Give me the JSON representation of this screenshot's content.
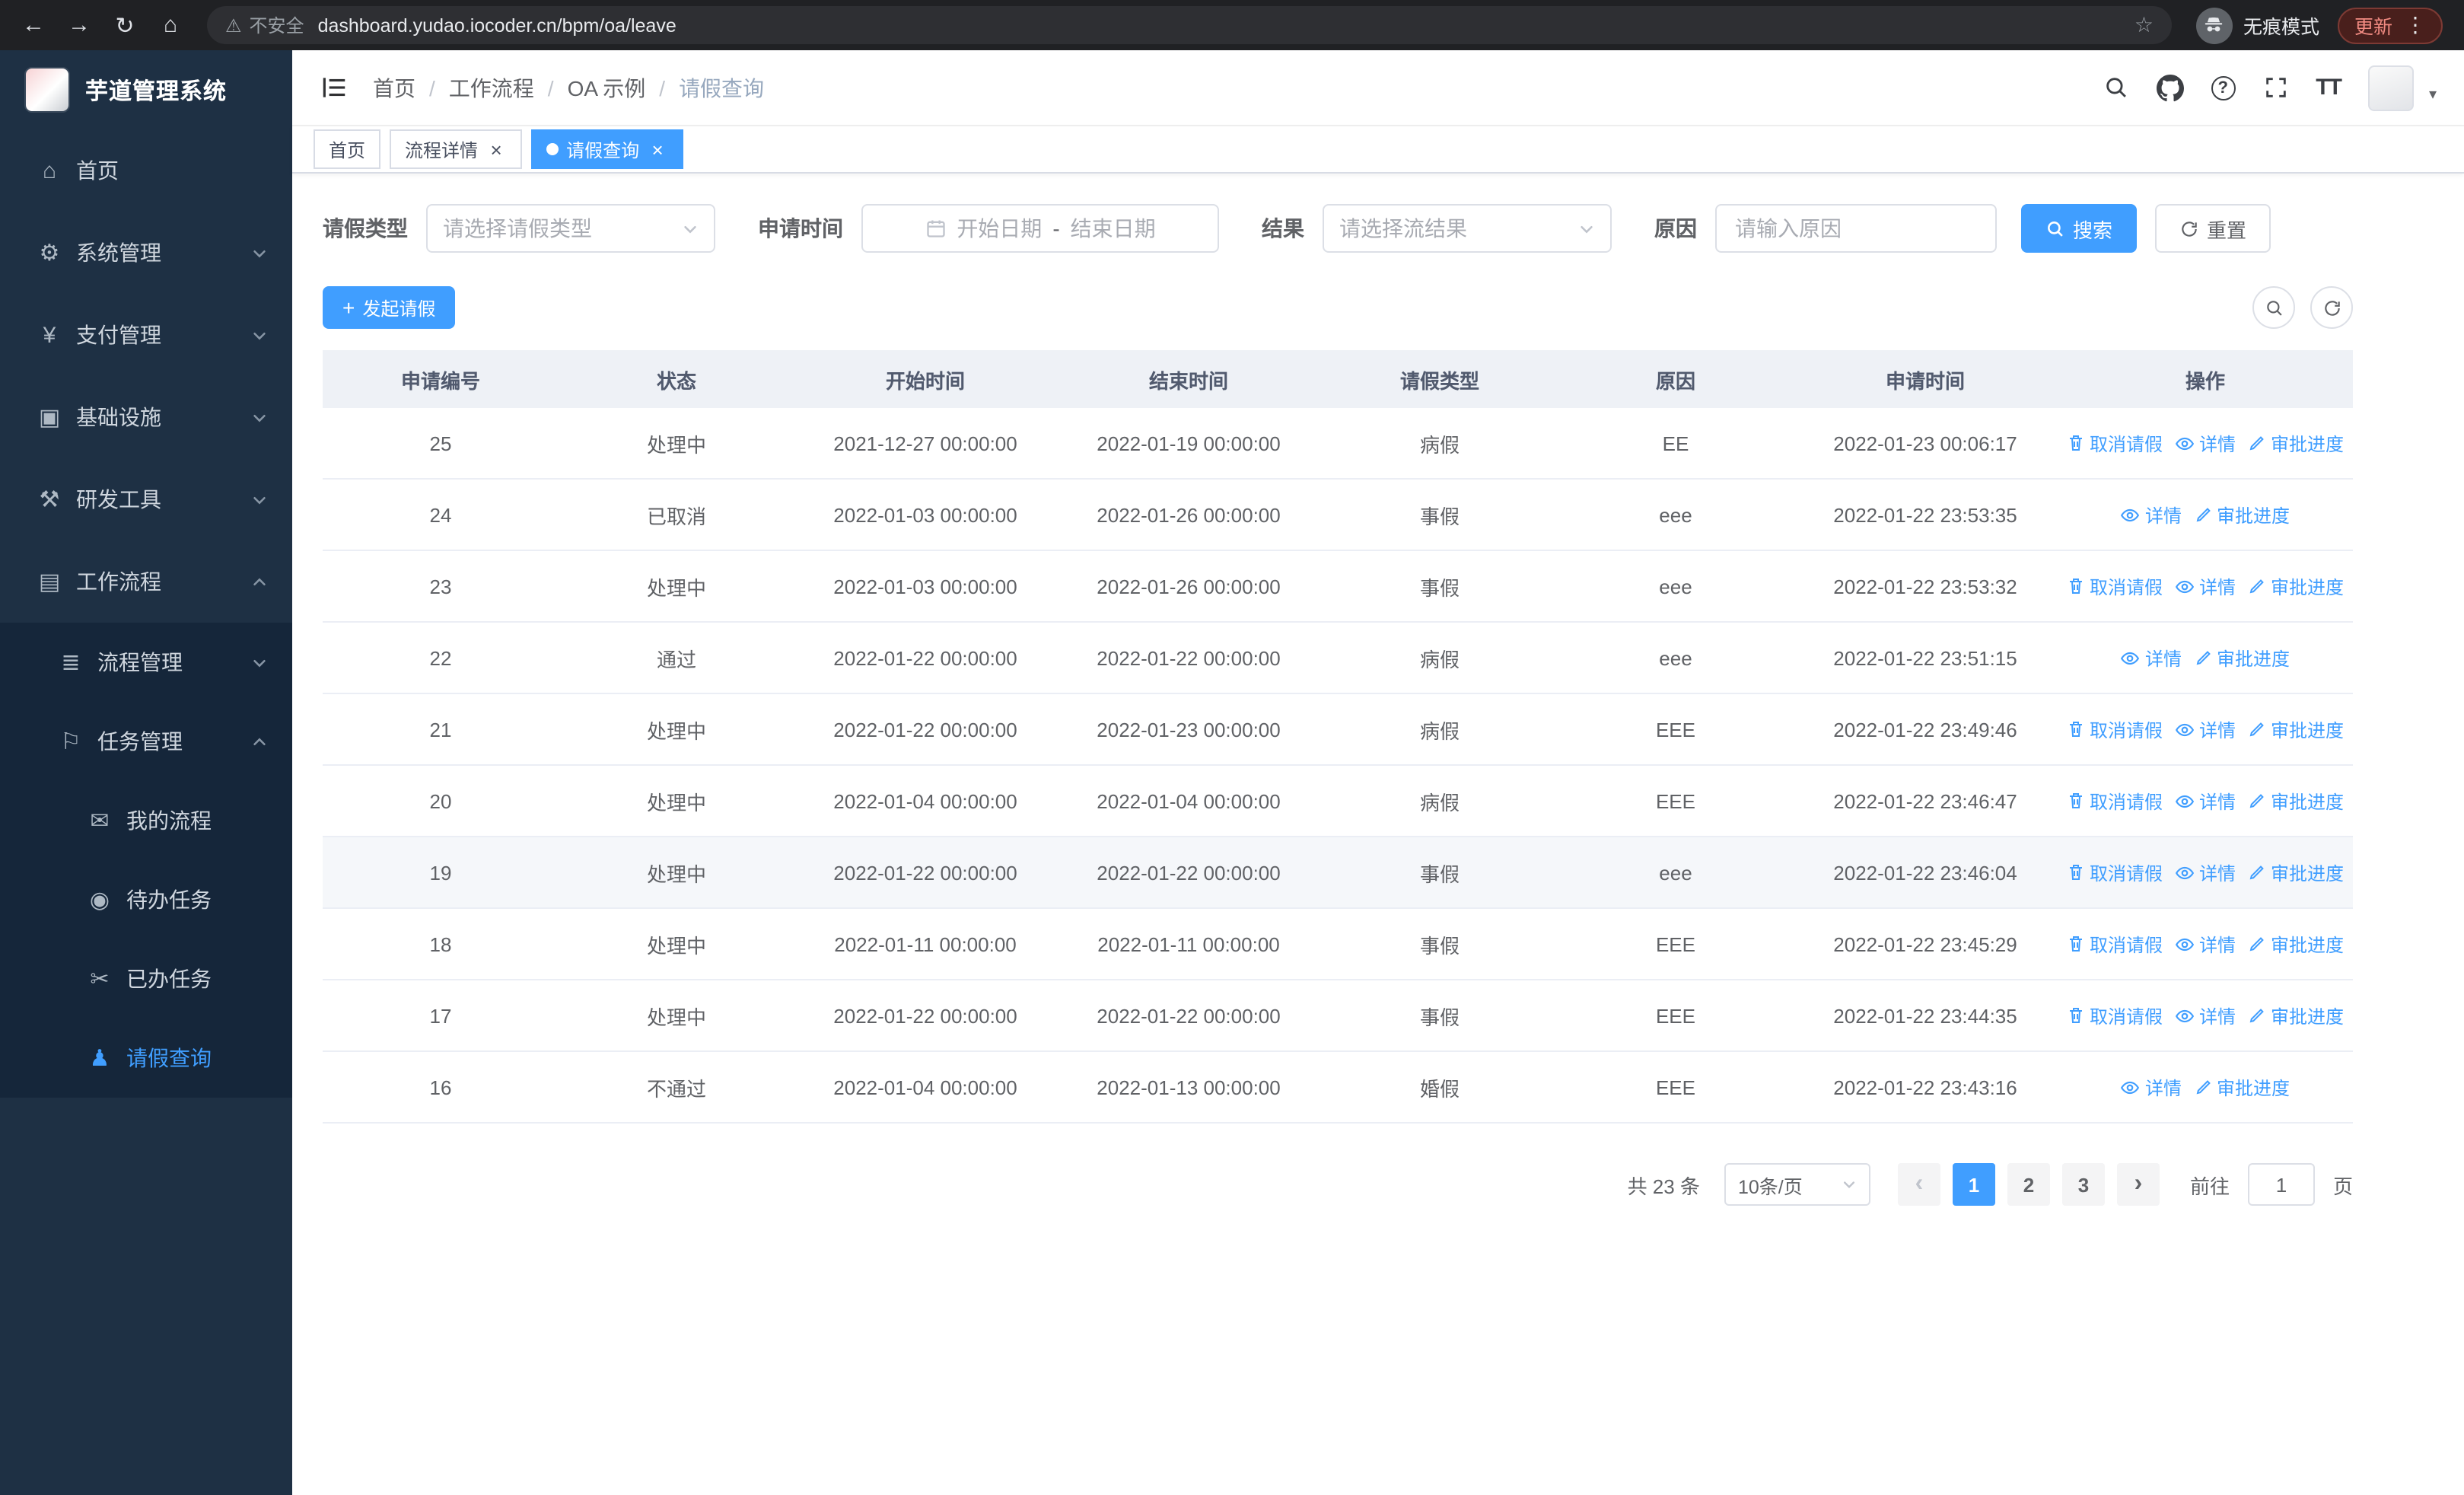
{
  "browser": {
    "warning": "不安全",
    "url": "dashboard.yudao.iocoder.cn/bpm/oa/leave",
    "incognito": "无痕模式",
    "update": "更新"
  },
  "icons": {
    "back": "←",
    "forward": "→",
    "reload": "↻",
    "home": "⌂",
    "warning": "⚠",
    "star": "☆",
    "dots": "⋮",
    "close": "×",
    "plus": "+",
    "help": "?",
    "text_size": "TT",
    "caret_down": "▾",
    "chevron_left": "‹",
    "chevron_right": "›",
    "dashboard": "⌂",
    "gear": "⚙",
    "payment": "¥",
    "infrastructure": "▣",
    "tools": "⚒",
    "workflow": "▤",
    "process": "≣",
    "task": "⚐",
    "chat": "✉",
    "eye": "◉",
    "done": "✂",
    "user": "♟"
  },
  "sidebar": {
    "title": "芋道管理系统",
    "items": [
      {
        "name": "home",
        "label": "首页",
        "icon": "dashboard",
        "level": 1
      },
      {
        "name": "system",
        "label": "系统管理",
        "icon": "gear",
        "level": 1,
        "chevron": "down"
      },
      {
        "name": "payment",
        "label": "支付管理",
        "icon": "payment",
        "level": 1,
        "chevron": "down"
      },
      {
        "name": "infrastructure",
        "label": "基础设施",
        "icon": "infrastructure",
        "level": 1,
        "chevron": "down"
      },
      {
        "name": "devtools",
        "label": "研发工具",
        "icon": "tools",
        "level": 1,
        "chevron": "down"
      },
      {
        "name": "workflow",
        "label": "工作流程",
        "icon": "workflow",
        "level": 1,
        "chevron": "up"
      },
      {
        "name": "process-mgmt",
        "label": "流程管理",
        "icon": "process",
        "level": 2,
        "chevron": "down",
        "sub": true
      },
      {
        "name": "task-mgmt",
        "label": "任务管理",
        "icon": "task",
        "level": 2,
        "chevron": "up",
        "sub": true
      },
      {
        "name": "my-process",
        "label": "我的流程",
        "icon": "chat",
        "level": 3,
        "sub": true
      },
      {
        "name": "todo-task",
        "label": "待办任务",
        "icon": "eye",
        "level": 3,
        "sub": true
      },
      {
        "name": "done-task",
        "label": "已办任务",
        "icon": "done",
        "level": 3,
        "sub": true
      },
      {
        "name": "leave-query",
        "label": "请假查询",
        "icon": "user",
        "level": 3,
        "sub": true,
        "active": true
      }
    ]
  },
  "header": {
    "breadcrumb": [
      {
        "label": "首页"
      },
      {
        "label": "工作流程"
      },
      {
        "label": "OA 示例"
      },
      {
        "label": "请假查询",
        "current": true
      }
    ]
  },
  "tabs": [
    {
      "name": "home",
      "label": "首页"
    },
    {
      "name": "process-detail",
      "label": "流程详情",
      "closable": true
    },
    {
      "name": "leave-query",
      "label": "请假查询",
      "closable": true,
      "active": true
    }
  ],
  "filters": {
    "type_label": "请假类型",
    "type_placeholder": "请选择请假类型",
    "time_label": "申请时间",
    "time_start": "开始日期",
    "time_sep": "-",
    "time_end": "结束日期",
    "result_label": "结果",
    "result_placeholder": "请选择流结果",
    "reason_label": "原因",
    "reason_placeholder": "请输入原因",
    "search": "搜索",
    "reset": "重置"
  },
  "toolbar": {
    "create": "发起请假"
  },
  "table": {
    "columns": [
      "申请编号",
      "状态",
      "开始时间",
      "结束时间",
      "请假类型",
      "原因",
      "申请时间",
      "操作"
    ],
    "action_labels": {
      "cancel": "取消请假",
      "detail": "详情",
      "progress": "审批进度"
    },
    "rows": [
      {
        "id": "25",
        "status": "处理中",
        "start": "2021-12-27 00:00:00",
        "end": "2022-01-19 00:00:00",
        "type": "病假",
        "reason": "EE",
        "applied": "2022-01-23 00:06:17",
        "actions": [
          "cancel",
          "detail",
          "progress"
        ]
      },
      {
        "id": "24",
        "status": "已取消",
        "start": "2022-01-03 00:00:00",
        "end": "2022-01-26 00:00:00",
        "type": "事假",
        "reason": "eee",
        "applied": "2022-01-22 23:53:35",
        "actions": [
          "detail",
          "progress"
        ]
      },
      {
        "id": "23",
        "status": "处理中",
        "start": "2022-01-03 00:00:00",
        "end": "2022-01-26 00:00:00",
        "type": "事假",
        "reason": "eee",
        "applied": "2022-01-22 23:53:32",
        "actions": [
          "cancel",
          "detail",
          "progress"
        ]
      },
      {
        "id": "22",
        "status": "通过",
        "start": "2022-01-22 00:00:00",
        "end": "2022-01-22 00:00:00",
        "type": "病假",
        "reason": "eee",
        "applied": "2022-01-22 23:51:15",
        "actions": [
          "detail",
          "progress"
        ]
      },
      {
        "id": "21",
        "status": "处理中",
        "start": "2022-01-22 00:00:00",
        "end": "2022-01-23 00:00:00",
        "type": "病假",
        "reason": "EEE",
        "applied": "2022-01-22 23:49:46",
        "actions": [
          "cancel",
          "detail",
          "progress"
        ]
      },
      {
        "id": "20",
        "status": "处理中",
        "start": "2022-01-04 00:00:00",
        "end": "2022-01-04 00:00:00",
        "type": "病假",
        "reason": "EEE",
        "applied": "2022-01-22 23:46:47",
        "actions": [
          "cancel",
          "detail",
          "progress"
        ]
      },
      {
        "id": "19",
        "status": "处理中",
        "start": "2022-01-22 00:00:00",
        "end": "2022-01-22 00:00:00",
        "type": "事假",
        "reason": "eee",
        "applied": "2022-01-22 23:46:04",
        "actions": [
          "cancel",
          "detail",
          "progress"
        ],
        "highlighted": true
      },
      {
        "id": "18",
        "status": "处理中",
        "start": "2022-01-11 00:00:00",
        "end": "2022-01-11 00:00:00",
        "type": "事假",
        "reason": "EEE",
        "applied": "2022-01-22 23:45:29",
        "actions": [
          "cancel",
          "detail",
          "progress"
        ]
      },
      {
        "id": "17",
        "status": "处理中",
        "start": "2022-01-22 00:00:00",
        "end": "2022-01-22 00:00:00",
        "type": "事假",
        "reason": "EEE",
        "applied": "2022-01-22 23:44:35",
        "actions": [
          "cancel",
          "detail",
          "progress"
        ]
      },
      {
        "id": "16",
        "status": "不通过",
        "start": "2022-01-04 00:00:00",
        "end": "2022-01-13 00:00:00",
        "type": "婚假",
        "reason": "EEE",
        "applied": "2022-01-22 23:43:16",
        "actions": [
          "detail",
          "progress"
        ]
      }
    ]
  },
  "pagination": {
    "total": "共 23 条",
    "page_size": "10条/页",
    "pages": [
      "1",
      "2",
      "3"
    ],
    "active": "1",
    "goto_label": "前往",
    "goto_value": "1",
    "goto_unit": "页"
  }
}
